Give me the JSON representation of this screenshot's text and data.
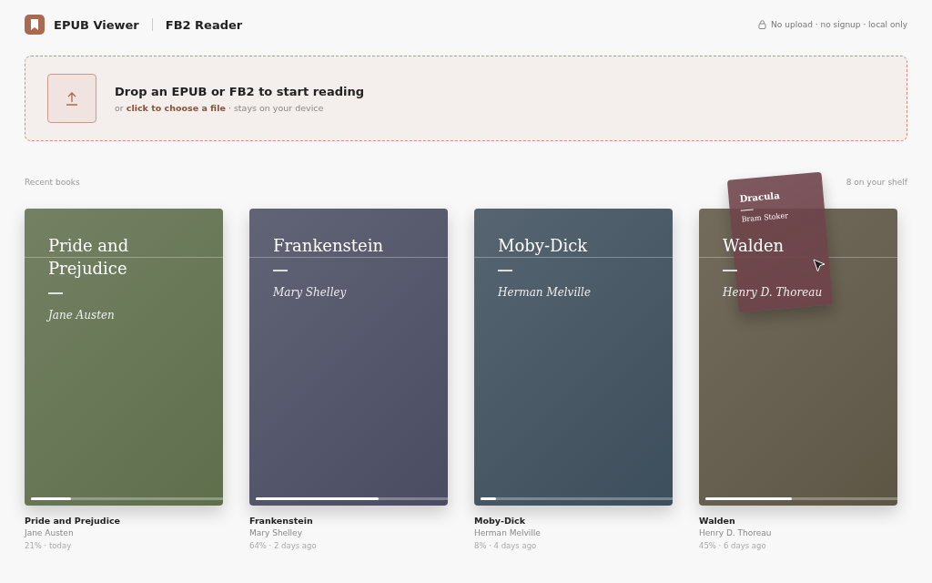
{
  "header": {
    "brand": "EPUB Viewer",
    "subtitle": "FB2 Reader",
    "privacy": "No upload · no signup · local only"
  },
  "dropzone": {
    "title": "Drop an EPUB or FB2 to start reading",
    "prefix": "or",
    "link": "click to choose a file",
    "suffix": "· stays on your device"
  },
  "shelf": {
    "heading": "Recent books",
    "count": "8 on your shelf"
  },
  "books": [
    {
      "cover_title": "Pride and Prejudice",
      "cover_author": "Jane Austen",
      "level": 0.21,
      "title": "Pride and Prejudice",
      "author": "Jane Austen",
      "meta": "21% · today",
      "color": "#5f6f4c"
    },
    {
      "cover_title": "Frankenstein",
      "cover_author": "Mary Shelley",
      "level": 0.64,
      "title": "Frankenstein",
      "author": "Mary Shelley",
      "meta": "64% · 2 days ago",
      "color": "#4a4d62"
    },
    {
      "cover_title": "Moby-Dick",
      "cover_author": "Herman Melville",
      "level": 0.08,
      "title": "Moby-Dick",
      "author": "Herman Melville",
      "meta": "8% · 4 days ago",
      "color": "#3d4e5c"
    },
    {
      "cover_title": "Walden",
      "cover_author": "Henry D. Thoreau",
      "level": 0.45,
      "title": "Walden",
      "author": "Henry D. Thoreau",
      "meta": "45% · 6 days ago",
      "color": "#5e5645"
    }
  ],
  "dragging": {
    "title": "Dracula",
    "author": "Bram Stoker",
    "color": "#6e444a"
  }
}
